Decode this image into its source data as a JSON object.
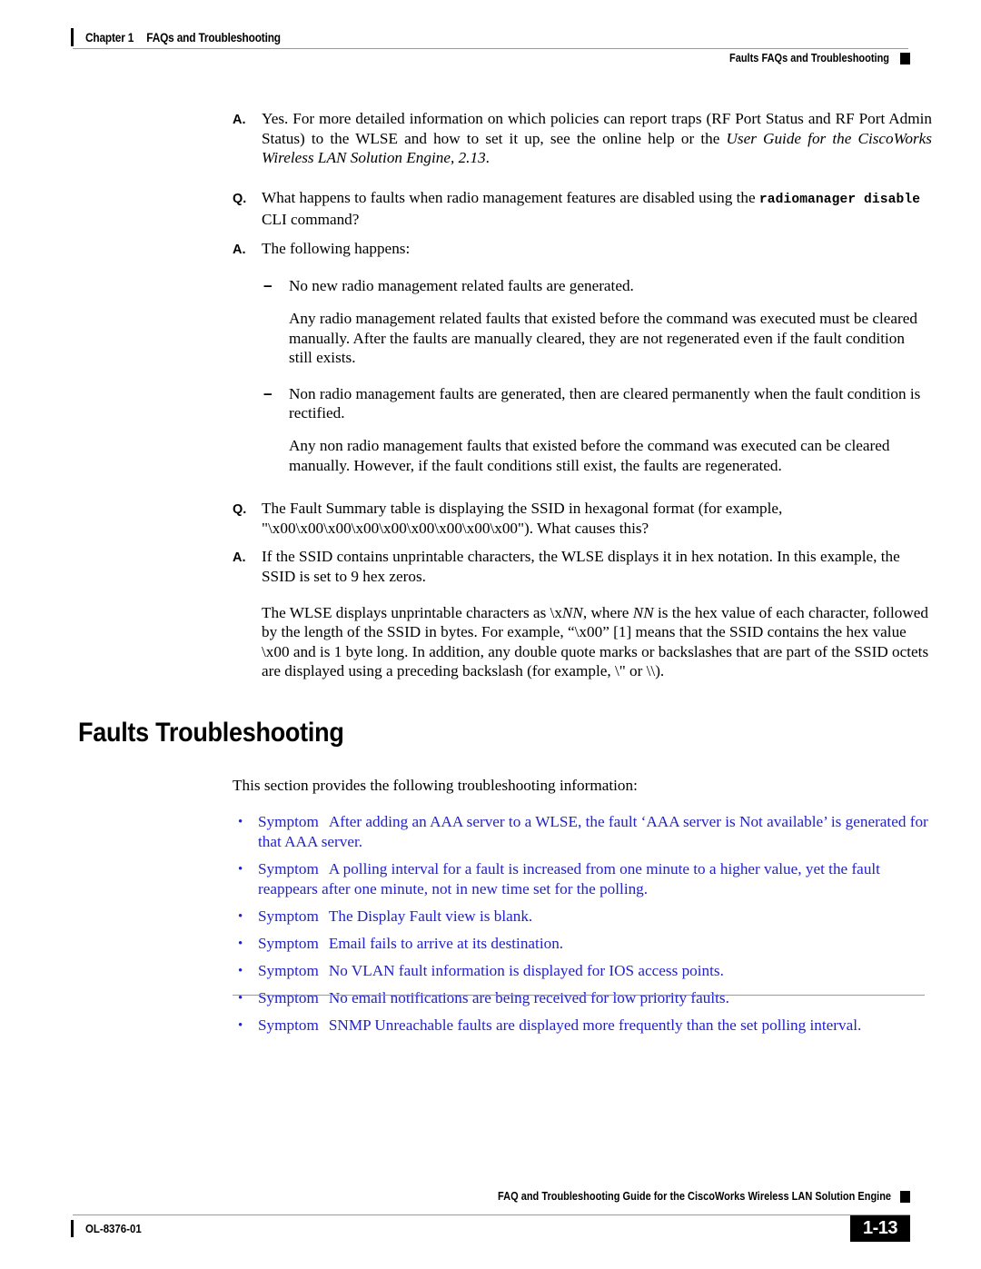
{
  "header": {
    "chapter": "Chapter 1",
    "chapter_title": "FAQs and Troubleshooting",
    "running_head": "Faults FAQs and Troubleshooting"
  },
  "footer": {
    "book_title": "FAQ and Troubleshooting Guide for the CiscoWorks Wireless LAN Solution Engine",
    "doc_id": "OL-8376-01",
    "page_number": "1-13"
  },
  "colors": {
    "link_blue": "#2222CC",
    "rule_gray": "#9A9A9A",
    "text_black": "#000000"
  },
  "body": {
    "qa1": {
      "marker": "A.",
      "text_1": "Yes. For more detailed information on which policies can report traps (RF Port Status and RF Port Admin Status) to the WLSE and how to set it up, see the online help or the ",
      "italic_1": "User Guide for the CiscoWorks Wireless LAN Solution Engine, 2.13",
      "text_2": "."
    },
    "qa2": {
      "marker": "Q.",
      "text_1": "What happens to faults when radio management features are disabled using the ",
      "mono_1": "radiomanager disable",
      "text_2": " CLI command?"
    },
    "qa3": {
      "marker": "A.",
      "text_1": "The following happens:"
    },
    "dash1": {
      "marker": "–",
      "text": "No new radio management related faults are generated."
    },
    "dash1_para": "Any radio management related faults that existed before the command was executed must be cleared manually. After the faults are manually cleared, they are not regenerated even if the fault condition still exists.",
    "dash2": {
      "marker": "–",
      "text": "Non radio management faults are generated, then are cleared permanently when the fault condition is rectified."
    },
    "dash2_para": "Any non radio management faults that existed before the command was executed can be cleared manually. However, if the fault conditions still exist, the faults are regenerated.",
    "qa4": {
      "marker": "Q.",
      "text_1": "The Fault Summary table is displaying the SSID in hexagonal format (for example, \"\\x00\\x00\\x00\\x00\\x00\\x00\\x00\\x00\\x00\"). What causes this?"
    },
    "qa5": {
      "marker": "A.",
      "text_1": "If the SSID contains unprintable characters, the WLSE displays it in hex notation. In this example, the SSID is set to 9 hex zeros."
    },
    "para_final": {
      "text_1": "The WLSE displays unprintable characters as \\x",
      "italic_1": "NN",
      "text_2": ", where ",
      "italic_2": "NN",
      "text_3": " is the hex value of each character, followed by the length of the SSID in bytes. For example, “\\x00” [1] means that the SSID contains the hex value \\x00 and is 1 byte long. In addition, any double quote marks or backslashes that are part of the SSID octets are displayed using a preceding backslash (for example, \\\" or \\\\)."
    }
  },
  "section": {
    "heading": "Faults Troubleshooting",
    "intro": "This section provides the following troubleshooting information:",
    "symptom_label": "Symptom",
    "items": [
      "After adding an AAA server to a WLSE, the fault ‘AAA server is Not available’ is generated for that AAA server.",
      "A polling interval for a fault is increased from one minute to a higher value, yet the fault reappears after one minute, not in new time set for the polling.",
      "The Display Fault view is blank.",
      "Email fails to arrive at its destination.",
      "No VLAN fault information is displayed for IOS access points.",
      "No email notifications are being received for low priority faults.",
      "SNMP Unreachable faults are displayed more frequently than the set polling interval."
    ],
    "bullet_glyph": "•"
  }
}
